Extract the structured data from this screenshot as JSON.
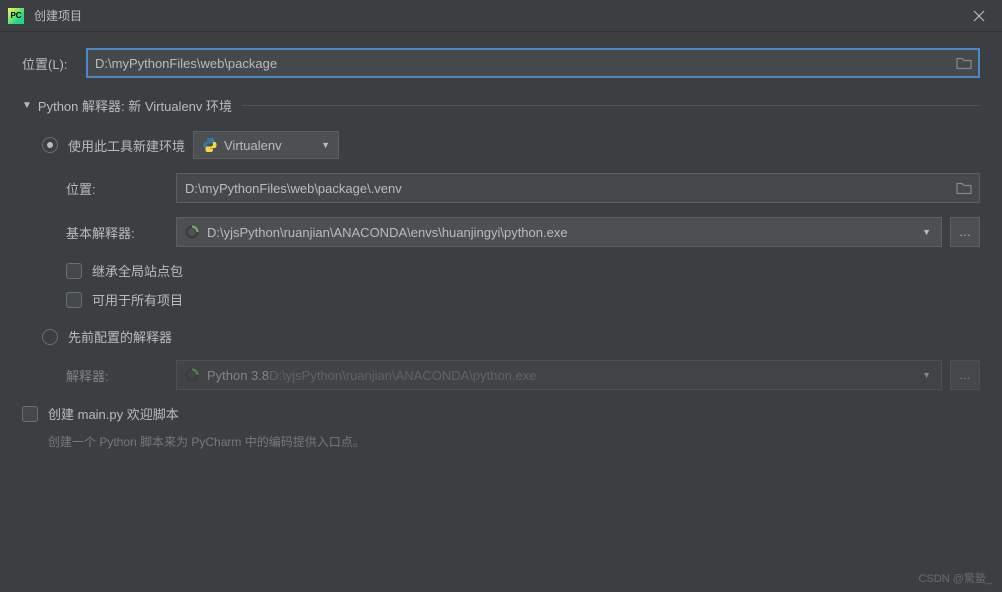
{
  "titlebar": {
    "title": "创建项目",
    "app_icon_text": "PC"
  },
  "location": {
    "label": "位置(L):",
    "value": "D:\\myPythonFiles\\web\\package"
  },
  "interpreter_section": {
    "header": "Python 解释器: 新 Virtualenv 环境",
    "new_env": {
      "radio_label": "使用此工具新建环境",
      "tool": "Virtualenv",
      "location_label": "位置:",
      "location_value": "D:\\myPythonFiles\\web\\package\\.venv",
      "base_label": "基本解释器:",
      "base_value": "D:\\yjsPython\\ruanjian\\ANACONDA\\envs\\huanjingyi\\python.exe",
      "inherit": "继承全局站点包",
      "all_projects": "可用于所有项目"
    },
    "configured": {
      "radio_label": "先前配置的解释器",
      "interp_label": "解释器:",
      "interp_name": "Python 3.8 ",
      "interp_path": "D:\\yjsPython\\ruanjian\\ANACONDA\\python.exe"
    }
  },
  "welcome": {
    "label": "创建 main.py 欢迎脚本",
    "hint": "创建一个 Python 脚本来为 PyCharm 中的编码提供入口点。"
  },
  "watermark": "CSDN @驚蟄_"
}
